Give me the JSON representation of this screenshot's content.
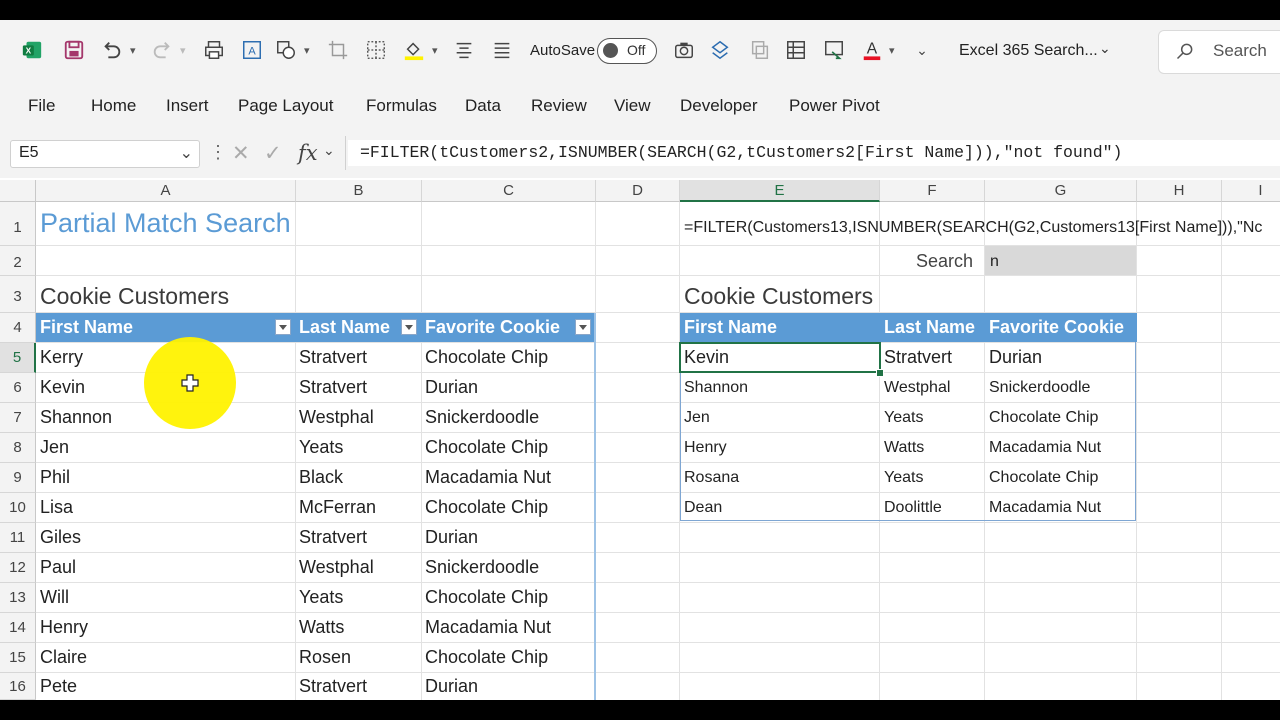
{
  "qat": {
    "autosave_label": "AutoSave",
    "autosave_state": "Off",
    "workbook_title": "Excel 365 Search...",
    "search_placeholder": "Search"
  },
  "ribbon": {
    "tabs": [
      "File",
      "Home",
      "Insert",
      "Page Layout",
      "Formulas",
      "Data",
      "Review",
      "View",
      "Developer",
      "Power Pivot"
    ]
  },
  "formula_bar": {
    "name_box": "E5",
    "fx": "fx",
    "formula": "=FILTER(tCustomers2,ISNUMBER(SEARCH(G2,tCustomers2[First Name])),\"not found\")"
  },
  "columns": [
    "A",
    "B",
    "C",
    "D",
    "E",
    "F",
    "G",
    "H",
    "I"
  ],
  "rows": [
    "1",
    "2",
    "3",
    "4",
    "5",
    "6",
    "7",
    "8",
    "9",
    "10",
    "11",
    "12",
    "13",
    "14",
    "15",
    "16"
  ],
  "sheet": {
    "title": "Partial Match Search",
    "left_table_title": "Cookie Customers",
    "right_table_title": "Cookie Customers",
    "e1_formula_text": "=FILTER(Customers13,ISNUMBER(SEARCH(G2,Customers13[First Name])),\"Nc",
    "search_label": "Search",
    "search_value": "n",
    "headers": [
      "First Name",
      "Last Name",
      "Favorite Cookie"
    ],
    "left_rows": [
      [
        "Kerry",
        "Stratvert",
        "Chocolate Chip"
      ],
      [
        "Kevin",
        "Stratvert",
        "Durian"
      ],
      [
        "Shannon",
        "Westphal",
        "Snickerdoodle"
      ],
      [
        "Jen",
        "Yeats",
        "Chocolate Chip"
      ],
      [
        "Phil",
        "Black",
        "Macadamia Nut"
      ],
      [
        "Lisa",
        "McFerran",
        "Chocolate Chip"
      ],
      [
        "Giles",
        "Stratvert",
        "Durian"
      ],
      [
        "Paul",
        "Westphal",
        "Snickerdoodle"
      ],
      [
        "Will",
        "Yeats",
        "Chocolate Chip"
      ],
      [
        "Henry",
        "Watts",
        "Macadamia Nut"
      ],
      [
        "Claire",
        "Rosen",
        "Chocolate Chip"
      ],
      [
        "Pete",
        "Stratvert",
        "Durian"
      ]
    ],
    "right_rows": [
      [
        "Kevin",
        "Stratvert",
        "Durian"
      ],
      [
        "Shannon",
        "Westphal",
        "Snickerdoodle"
      ],
      [
        "Jen",
        "Yeats",
        "Chocolate Chip"
      ],
      [
        "Henry",
        "Watts",
        "Macadamia Nut"
      ],
      [
        "Rosana",
        "Yeats",
        "Chocolate Chip"
      ],
      [
        "Dean",
        "Doolittle",
        "Macadamia Nut"
      ]
    ]
  },
  "colors": {
    "table_header": "#5b9bd5",
    "excel_green": "#217346",
    "cursor_highlight": "#fff200"
  }
}
